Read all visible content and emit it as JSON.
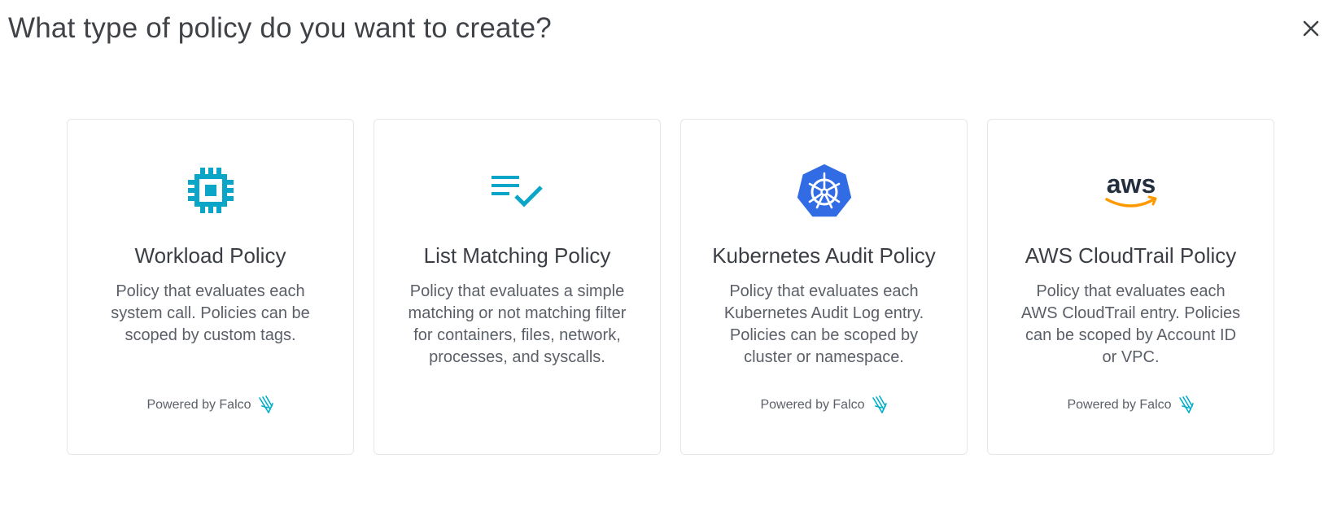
{
  "dialog": {
    "title": "What type of policy do you want to create?",
    "close_icon": "close-icon"
  },
  "colors": {
    "teal": "#0aa5c7",
    "kubernetes_blue": "#326ce5",
    "aws_orange": "#ff9900",
    "aws_text": "#232f3e",
    "falco_teal": "#00aec7"
  },
  "cards": [
    {
      "icon": "cpu-chip-icon",
      "title": "Workload Policy",
      "description": "Policy that evaluates each system call. Policies can be scoped by custom tags.",
      "powered_by": "Powered by Falco"
    },
    {
      "icon": "list-check-icon",
      "title": "List Matching Policy",
      "description": "Policy that evaluates a simple matching or not matching filter for containers, files, network, processes, and syscalls.",
      "powered_by": ""
    },
    {
      "icon": "kubernetes-icon",
      "title": "Kubernetes Audit Policy",
      "description": "Policy that evaluates each Kubernetes Audit Log entry. Policies can be scoped by cluster or namespace.",
      "powered_by": "Powered by Falco"
    },
    {
      "icon": "aws-logo-icon",
      "logo_text": "aws",
      "title": "AWS CloudTrail Policy",
      "description": "Policy that evaluates each AWS CloudTrail entry. Policies can be scoped by Account ID or VPC.",
      "powered_by": "Powered by Falco"
    }
  ]
}
